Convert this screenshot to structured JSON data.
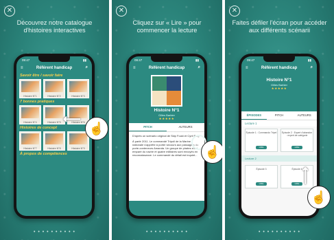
{
  "panels": [
    {
      "caption": "Découvrez notre catalogue d'histoires interactives",
      "app_title": "Référent handicap",
      "status_time": "09:47",
      "sections": [
        {
          "title": "Savoir être / savoir faire",
          "tiles": [
            "Histoire N°1",
            "Histoire N°2",
            "Histoire N°3"
          ]
        },
        {
          "title": "7 bonnes pratiques",
          "tiles": [
            "Histoire N°4",
            "Histoire N°5",
            "Histoire N°6"
          ]
        },
        {
          "title": "Histoires de concept",
          "tiles": [
            "Histoire N°7",
            "Histoire N°8",
            "Histoire N°9"
          ]
        },
        {
          "title": "À propos de compétences",
          "tiles": []
        }
      ]
    },
    {
      "caption": "Cliquez sur « Lire » pour commencer la lecture",
      "app_title": "Référent handicap",
      "status_time": "09:47",
      "story_title": "Histoire N°1",
      "story_author": "Gilles Barbier",
      "stars": "★★★★★",
      "tabs": [
        "PITCH",
        "AUTEURS"
      ],
      "paragraphs": [
        "D'après un scénario original de Skip Fouki et Cyril Puig",
        "À partir 2011. Le commandé Tripoli de la Marine nationale s'apprête à porter secours aux passagers du porte-conteneurs Amanda. Un groupe de pirates s'est emparé du navire et quatre militaires sont envoyés en reconnaissance. Le commandé du détail est inquiet..."
      ]
    },
    {
      "caption": "Faites défiler l'écran pour accéder aux différents scénarii",
      "app_title": "Référent handicap",
      "status_time": "09:47",
      "story_title": "Histoire N°1",
      "story_author": "Gilles Barbier",
      "stars": "★★★★★",
      "tabs": [
        "ÉPISODES",
        "PITCH",
        "AUTEURS"
      ],
      "lecture1": "Lecture 1",
      "lecture2": "Lecture 2",
      "cards_row1": [
        {
          "title": "Épisode 1 : Commando Tripel",
          "btn": "LIRE"
        },
        {
          "title": "Épisode 2 : Expert d'abandon : expert de catégorie",
          "btn": "LIRE"
        }
      ],
      "cards_row2": [
        {
          "title": "Épisode 3",
          "btn": "LIRE"
        },
        {
          "title": "Épisode 4",
          "btn": "LIRE"
        }
      ]
    }
  ],
  "dots": "• • • • • • • • • •",
  "colors": {
    "accent": "#2c8a81",
    "highlight": "#ffd24a"
  }
}
